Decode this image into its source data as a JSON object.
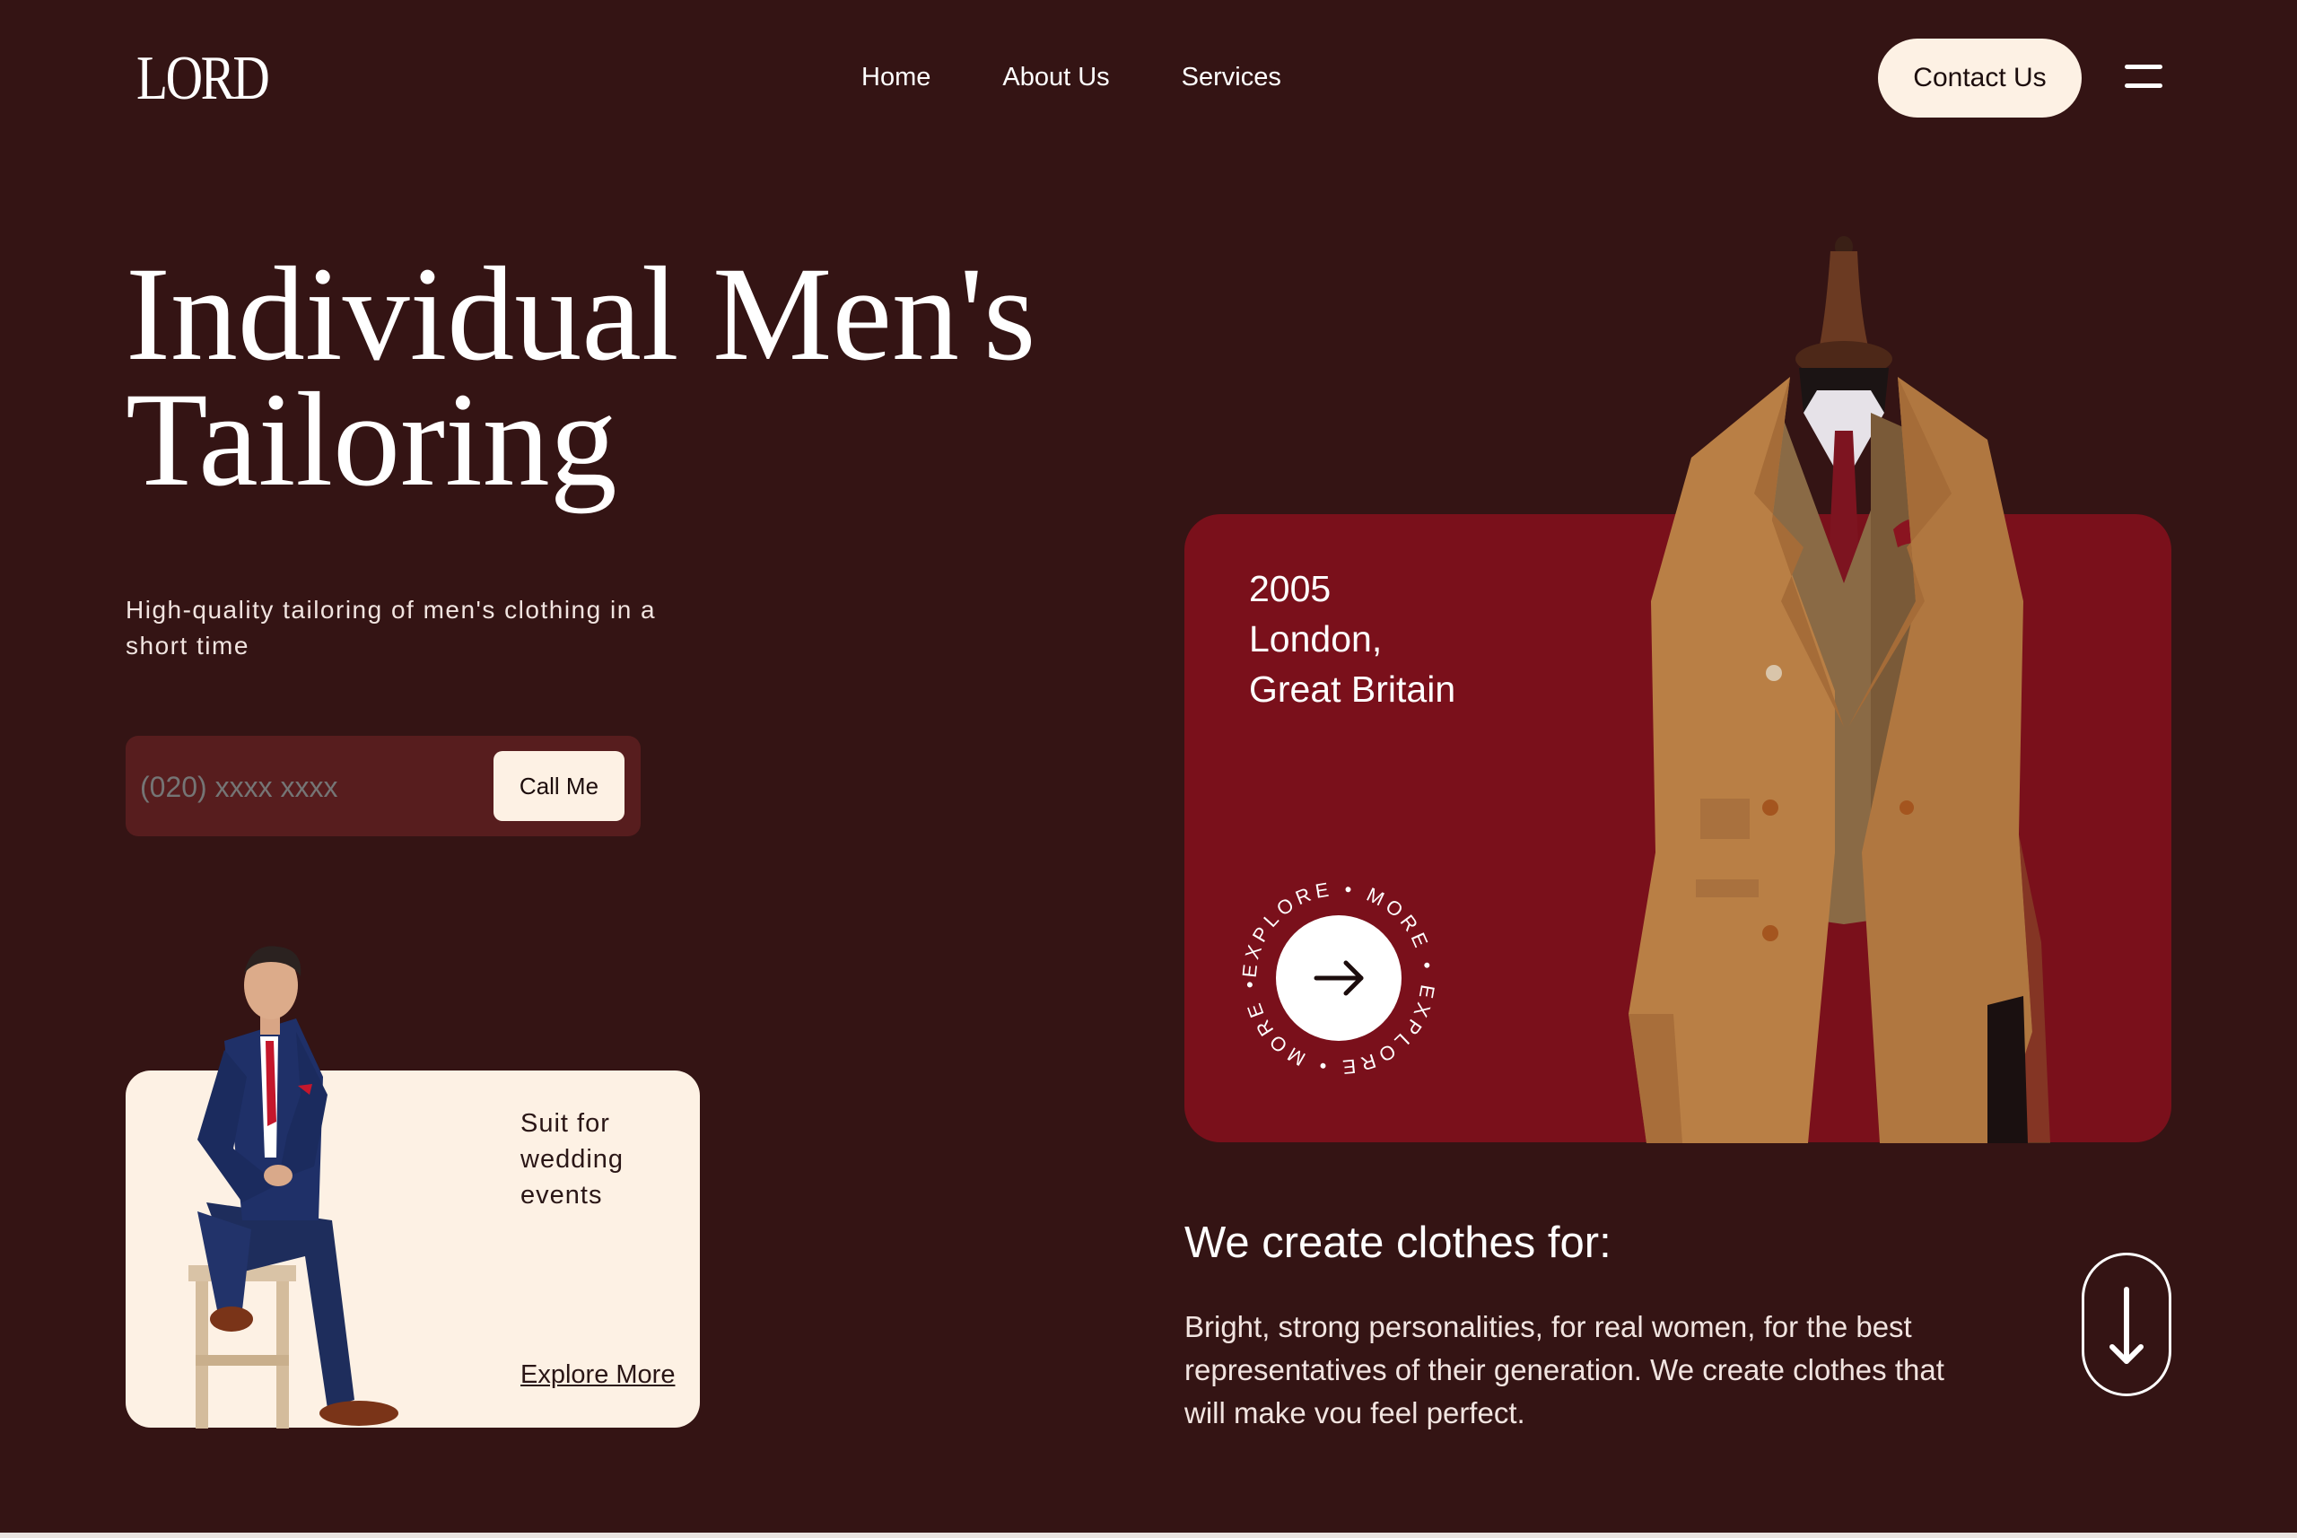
{
  "header": {
    "logo": "LORD",
    "nav": [
      "Home",
      "About Us",
      "Services"
    ],
    "contact_label": "Contact Us"
  },
  "hero": {
    "title_line1": "Individual Men's",
    "title_line2": "Tailoring",
    "subtitle": "High-quality tailoring of men's clothing in a short time",
    "phone_placeholder": "(020) xxxx xxxx",
    "call_label": "Call Me"
  },
  "suit_card": {
    "line1": "Suit for",
    "line2": "wedding",
    "line3": "events",
    "link": "Explore More"
  },
  "feature_card": {
    "year": "2005",
    "city": "London,",
    "country": "Great Britain",
    "badge_text": "EXPLORE • MORE • EXPLORE • MORE •"
  },
  "about": {
    "heading": "We create clothes for:",
    "body": "Bright, strong personalities, for real women, for the best representatives of their generation. We create clothes that will make vou feel perfect."
  },
  "colors": {
    "background": "#341414",
    "cream": "#fdf1e4",
    "card_red": "#7a101b",
    "phone_box": "#571d1e"
  },
  "icons": [
    "menu-icon",
    "arrow-right-icon",
    "arrow-down-icon"
  ]
}
